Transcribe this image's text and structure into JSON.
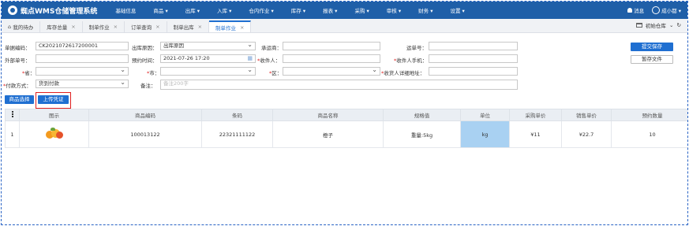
{
  "app": {
    "title": "蜘点WMS仓储管理系统"
  },
  "menu": [
    "基础信息",
    "商品",
    "出库",
    "入库",
    "仓内作业",
    "库存",
    "报表",
    "采购",
    "审核",
    "财务",
    "设置"
  ],
  "top_right": {
    "messages": "消息",
    "user": "成小都"
  },
  "tabs": [
    {
      "label": "我的待办",
      "closable": false
    },
    {
      "label": "库存总量",
      "closable": true
    },
    {
      "label": "制单作业",
      "closable": true
    },
    {
      "label": "订单查询",
      "closable": true
    },
    {
      "label": "制单出库",
      "closable": true
    },
    {
      "label": "制单作业",
      "closable": true,
      "active": true
    }
  ],
  "warehouse": {
    "label": "初始仓库"
  },
  "form": {
    "order_no_label": "单据编码：",
    "order_no_value": "CK2021072617200001",
    "reason_label": "出库原因：",
    "reason_value": "出库原因",
    "carrier_label": "承运商：",
    "tracking_label": "运单号：",
    "external_label": "外部单号：",
    "appoint_label": "预约时间：",
    "appoint_value": "2021-07-26 17:20",
    "receiver_label": "收件人：",
    "receiver_phone_label": "收件人手机：",
    "province_label": "省：",
    "city_label": "市：",
    "district_label": "区：",
    "address_label": "收货人详细地址：",
    "payment_label": "付款方式：",
    "payment_value": "货到付款",
    "remark_label": "备注：",
    "remark_placeholder": "备注200字"
  },
  "actions": {
    "submit": "提交保存",
    "draft": "暂存文件",
    "select_product": "商品选择",
    "upload": "上传凭证"
  },
  "table": {
    "headers": [
      "图示",
      "商品编码",
      "条码",
      "商品名称",
      "规格值",
      "单位",
      "采购单价",
      "销售单价",
      "预约数量",
      "备注"
    ],
    "rows": [
      {
        "index": "1",
        "code": "100013122",
        "barcode": "22321111122",
        "name": "橙子",
        "spec": "重量:5kg",
        "unit": "kg",
        "purchase": "¥11",
        "sale": "¥22.7",
        "qty": "10",
        "remark": ""
      }
    ]
  }
}
